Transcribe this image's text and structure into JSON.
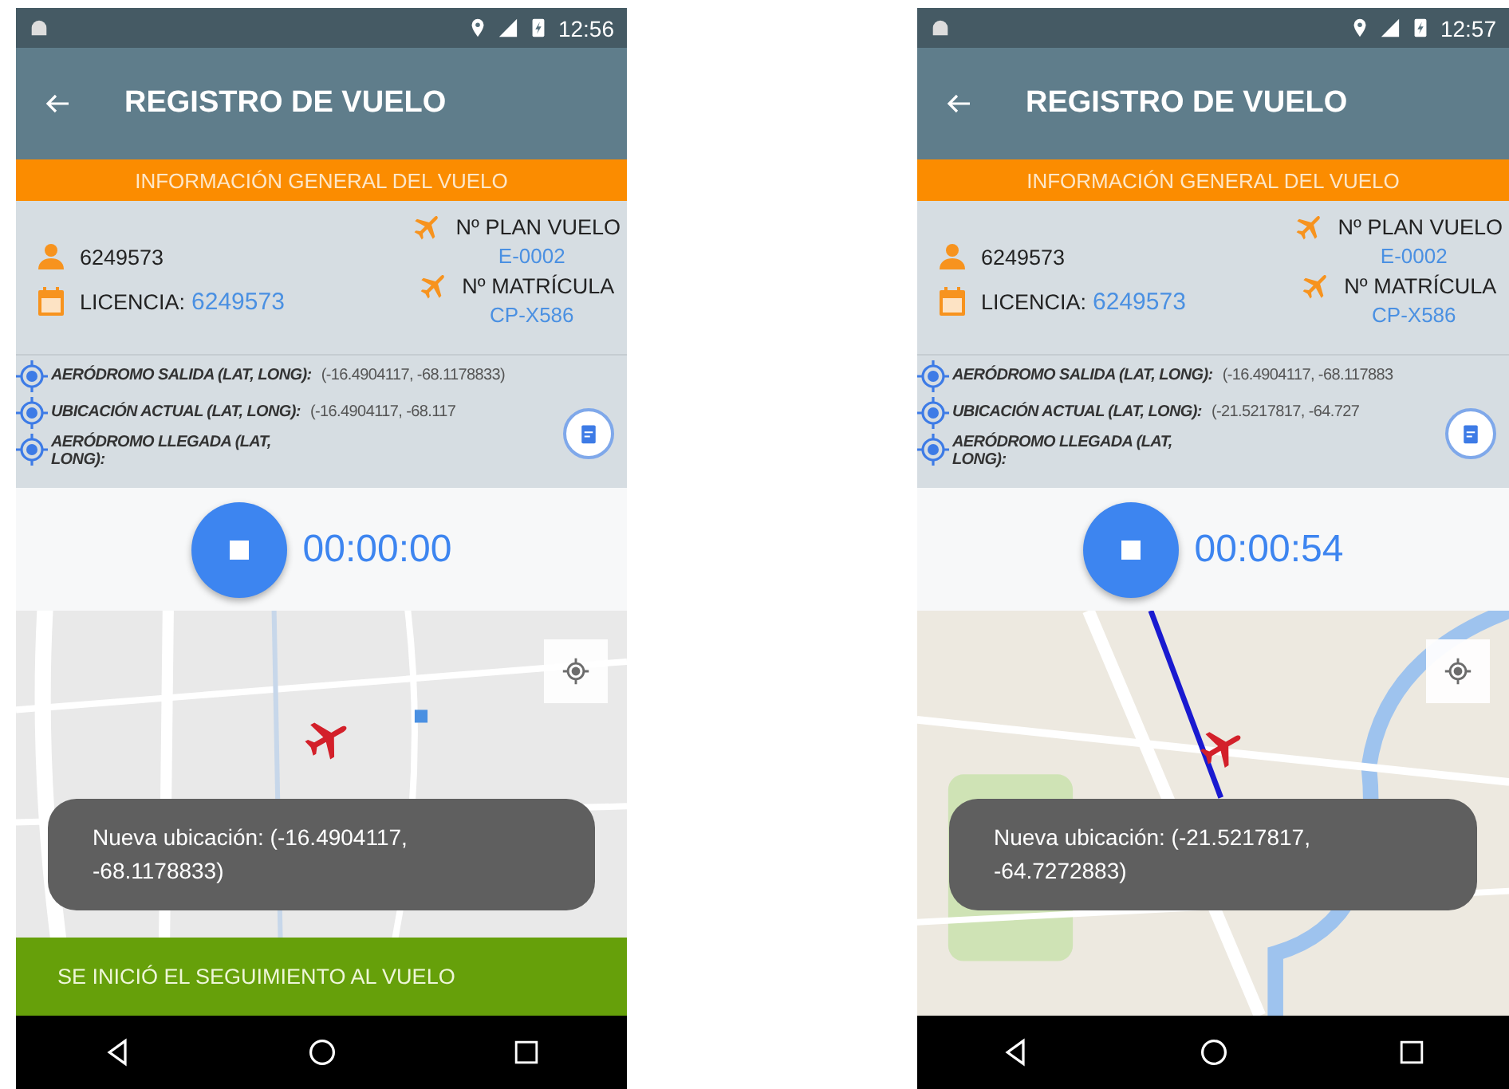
{
  "phones": [
    {
      "status_time": "12:56",
      "title": "REGISTRO DE VUELO",
      "section_title": "INFORMACIÓN GENERAL DEL VUELO",
      "pilot": "6249573",
      "license": {
        "label": "LICENCIA:",
        "value": "6249573"
      },
      "flight_plan": {
        "label": "Nº PLAN VUELO",
        "value": "E-0002"
      },
      "registration": {
        "label": "Nº MATRÍCULA",
        "value": "CP-X586"
      },
      "coordinates": [
        {
          "label": "AERÓDROMO SALIDA (LAT, LONG):",
          "value": "(-16.4904117, -68.1178833)"
        },
        {
          "label": "UBICACIÓN ACTUAL (LAT, LONG):",
          "value": "(-16.4904117, -68.117"
        },
        {
          "label": "AERÓDROMO LLEGADA (LAT, LONG):"
        }
      ],
      "timer": "00:00:00",
      "toast": "Nueva ubicación: (-16.4904117, -68.1178833)",
      "snackbar": "SE INICIÓ EL SEGUIMIENTO AL VUELO"
    },
    {
      "status_time": "12:57",
      "title": "REGISTRO DE VUELO",
      "section_title": "INFORMACIÓN GENERAL DEL VUELO",
      "pilot": "6249573",
      "license": {
        "label": "LICENCIA:",
        "value": "6249573"
      },
      "flight_plan": {
        "label": "Nº PLAN VUELO",
        "value": "E-0002"
      },
      "registration": {
        "label": "Nº MATRÍCULA",
        "value": "CP-X586"
      },
      "coordinates": [
        {
          "label": "AERÓDROMO SALIDA (LAT, LONG):",
          "value": "(-16.4904117, -68.117883"
        },
        {
          "label": "UBICACIÓN ACTUAL (LAT, LONG):",
          "value": "(-21.5217817, -64.727"
        },
        {
          "label": "AERÓDROMO LLEGADA (LAT, LONG):"
        }
      ],
      "timer": "00:00:54",
      "toast": "Nueva ubicación: (-21.5217817, -64.7272883)"
    }
  ]
}
